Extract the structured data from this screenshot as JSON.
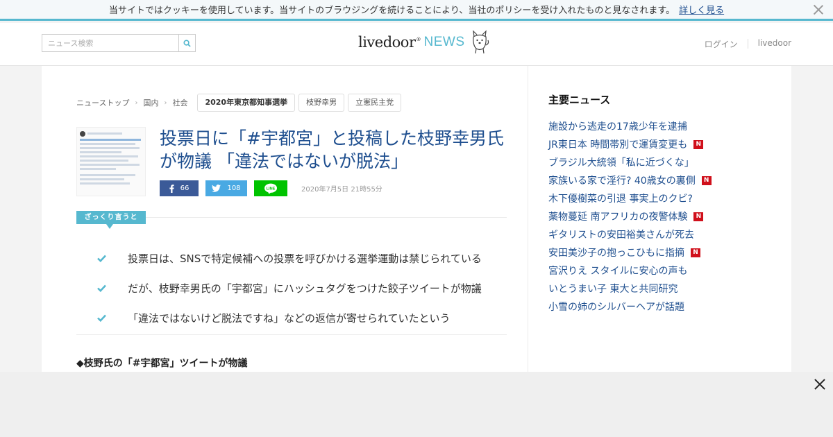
{
  "cookie": {
    "text": "当サイトではクッキーを使用しています。当サイトのブラウジングを続けることにより、当社のポリシーを受け入れたものと見なされます。",
    "link": "詳しく見る"
  },
  "header": {
    "search_placeholder": "ニュース検索",
    "logo_main": "livedoor",
    "logo_reg": "®",
    "logo_news": "NEWS",
    "login": "ログイン",
    "livedoor": "livedoor"
  },
  "breadcrumb": [
    "ニューストップ",
    "国内",
    "社会"
  ],
  "tags": [
    "2020年東京都知事選挙",
    "枝野幸男",
    "立憲民主党"
  ],
  "article": {
    "title": "投票日に「#宇都宮」と投稿した枝野幸男氏が物議 「違法ではないが脱法」",
    "facebook_count": "66",
    "twitter_count": "108",
    "line_label": "LINE",
    "date": "2020年7月5日 21時55分",
    "summary_label": "ざっくり言うと",
    "summary": [
      "投票日は、SNSで特定候補への投票を呼びかける選挙運動は禁じられている",
      "だが、枝野幸男氏の「宇都宮」にハッシュタグをつけた餃子ツイートが物議",
      "「違法ではないけど脱法ですね」などの返信が寄せられていたという"
    ],
    "subhead": "◆枝野氏の「#宇都宮」ツイートが物議"
  },
  "sidebar": {
    "title": "主要ニュース",
    "items": [
      {
        "text": "施設から逃走の17歳少年を逮捕",
        "badge": ""
      },
      {
        "text": "JR東日本 時間帯別で運賃変更も",
        "badge": "N"
      },
      {
        "text": "ブラジル大統領「私に近づくな」",
        "badge": ""
      },
      {
        "text": "家族いる家で淫行? 40歳女の裏側",
        "badge": "N"
      },
      {
        "text": "木下優樹菜の引退 事実上のクビ?",
        "badge": ""
      },
      {
        "text": "薬物蔓延 南アフリカの夜警体験",
        "badge": "N"
      },
      {
        "text": "ギタリストの安田裕美さんが死去",
        "badge": ""
      },
      {
        "text": "安田美沙子の抱っこひもに指摘",
        "badge": "N"
      },
      {
        "text": "宮沢りえ スタイルに安心の声も",
        "badge": ""
      },
      {
        "text": "いとうまい子 東大と共同研究",
        "badge": ""
      },
      {
        "text": "小雪の姉のシルバーヘアが話題",
        "badge": ""
      }
    ]
  },
  "colors": {
    "accent": "#56b8cf",
    "link": "#1f4f8f",
    "facebook": "#3b5a98",
    "twitter": "#49a9e3",
    "line": "#00c300",
    "badge": "#d0101b"
  }
}
